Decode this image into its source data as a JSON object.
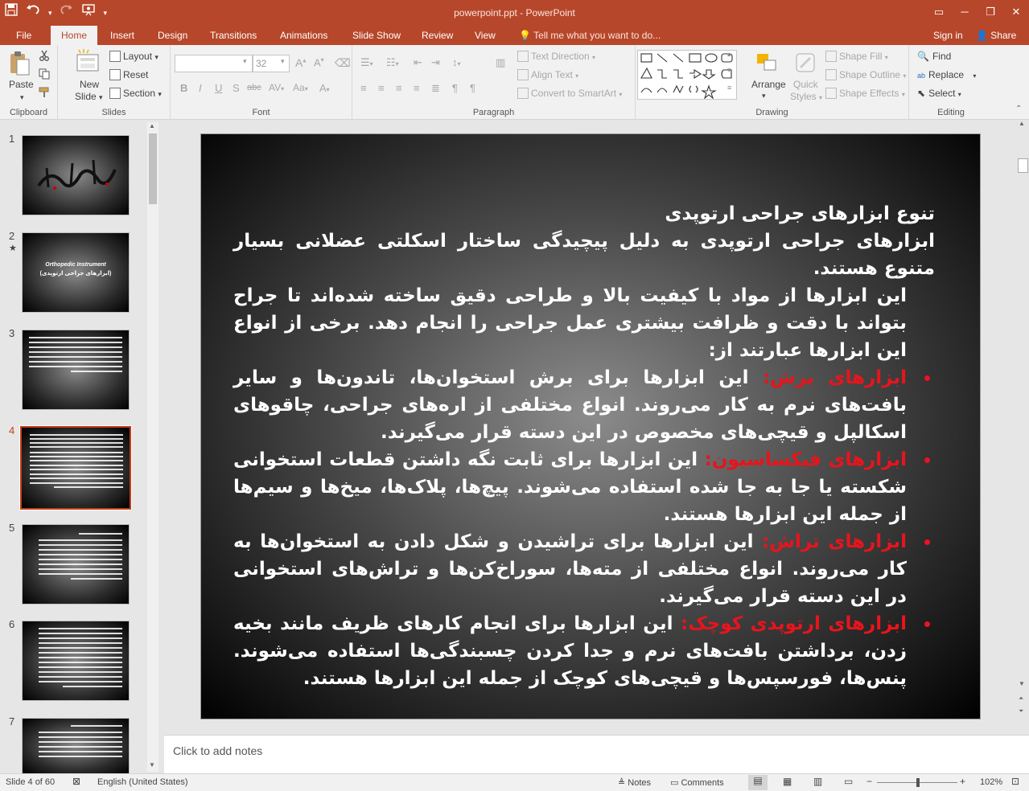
{
  "window": {
    "title": "powerpoint.ppt - PowerPoint",
    "qat": [
      "save-icon",
      "undo-icon",
      "redo-icon",
      "slideshow-icon",
      "customize-icon"
    ]
  },
  "tabs": [
    {
      "label": "File"
    },
    {
      "label": "Home",
      "active": true
    },
    {
      "label": "Insert"
    },
    {
      "label": "Design"
    },
    {
      "label": "Transitions"
    },
    {
      "label": "Animations"
    },
    {
      "label": "Slide Show"
    },
    {
      "label": "Review"
    },
    {
      "label": "View"
    }
  ],
  "tell_me": "Tell me what you want to do...",
  "account": {
    "signin": "Sign in",
    "share": "Share"
  },
  "ribbon": {
    "clipboard": {
      "label": "Clipboard",
      "paste": "Paste"
    },
    "slides": {
      "label": "Slides",
      "new_slide": "New",
      "new_slide2": "Slide",
      "layout": "Layout",
      "reset": "Reset",
      "section": "Section"
    },
    "font": {
      "label": "Font",
      "font_name": "",
      "font_size": "32"
    },
    "paragraph": {
      "label": "Paragraph",
      "text_direction": "Text Direction",
      "align_text": "Align Text",
      "smartart": "Convert to SmartArt"
    },
    "drawing": {
      "label": "Drawing",
      "arrange": "Arrange",
      "quick_styles": "Quick",
      "quick_styles2": "Styles",
      "shape_fill": "Shape Fill",
      "shape_outline": "Shape Outline",
      "shape_effects": "Shape Effects"
    },
    "editing": {
      "label": "Editing",
      "find": "Find",
      "replace": "Replace",
      "select": "Select"
    }
  },
  "thumbnails": [
    {
      "num": "1"
    },
    {
      "num": "2",
      "title1": "Orthopedic Instrument",
      "title2": "(ابزارهای جراحی ارتوپدی)"
    },
    {
      "num": "3"
    },
    {
      "num": "4",
      "current": true
    },
    {
      "num": "5"
    },
    {
      "num": "6"
    },
    {
      "num": "7"
    }
  ],
  "slide": {
    "heading": "تنوع ابزارهای جراحی ارتوپدی",
    "intro": "ابزارهای جراحی ارتوپدی به دلیل پیچیدگی ساختار اسکلتی عضلانی بسیار متنوع هستند.",
    "intro2": "این ابزارها از مواد با کیفیت بالا و طراحی دقیق ساخته شده‌اند تا جراح بتواند با دقت و ظرافت بیشتری عمل جراحی را انجام دهد. برخی از انواع این ابزارها عبارتند از:",
    "bullets": [
      {
        "term": "ابزارهای برش:",
        "text": " این ابزارها برای برش استخوان‌ها، تاندون‌ها و سایر بافت‌های نرم به کار می‌روند. انواع مختلفی از اره‌های جراحی، چاقوهای اسکالپل و قیچی‌های مخصوص در این دسته قرار می‌گیرند."
      },
      {
        "term": "ابزارهای فیکساسیون:",
        "text": " این ابزارها برای ثابت نگه داشتن قطعات استخوانی شکسته یا جا به جا شده استفاده می‌شوند. پیچ‌ها، پلاک‌ها، میخ‌ها و سیم‌ها از جمله این ابزارها هستند."
      },
      {
        "term": "ابزارهای تراش:",
        "text": " این ابزارها برای تراشیدن و شکل دادن به استخوان‌ها به کار می‌روند. انواع مختلفی از مته‌ها، سوراخ‌کن‌ها و تراش‌های استخوانی در این دسته قرار می‌گیرند."
      },
      {
        "term": "ابزارهای ارتوپدی کوچک:",
        "text": " این ابزارها برای انجام کارهای ظریف مانند بخیه زدن، برداشتن بافت‌های نرم و جدا کردن چسبندگی‌ها استفاده می‌شوند. پنس‌ها، فورسپس‌ها و قیچی‌های کوچک از جمله این ابزارها هستند."
      }
    ]
  },
  "notes_placeholder": "Click to add notes",
  "status": {
    "slide_info": "Slide 4 of 60",
    "language": "English (United States)",
    "notes": "Notes",
    "comments": "Comments",
    "zoom": "102%"
  },
  "colors": {
    "accent": "#b7472a",
    "bullet_term": "#e8141c",
    "current_thumb": "#c43e1c"
  }
}
